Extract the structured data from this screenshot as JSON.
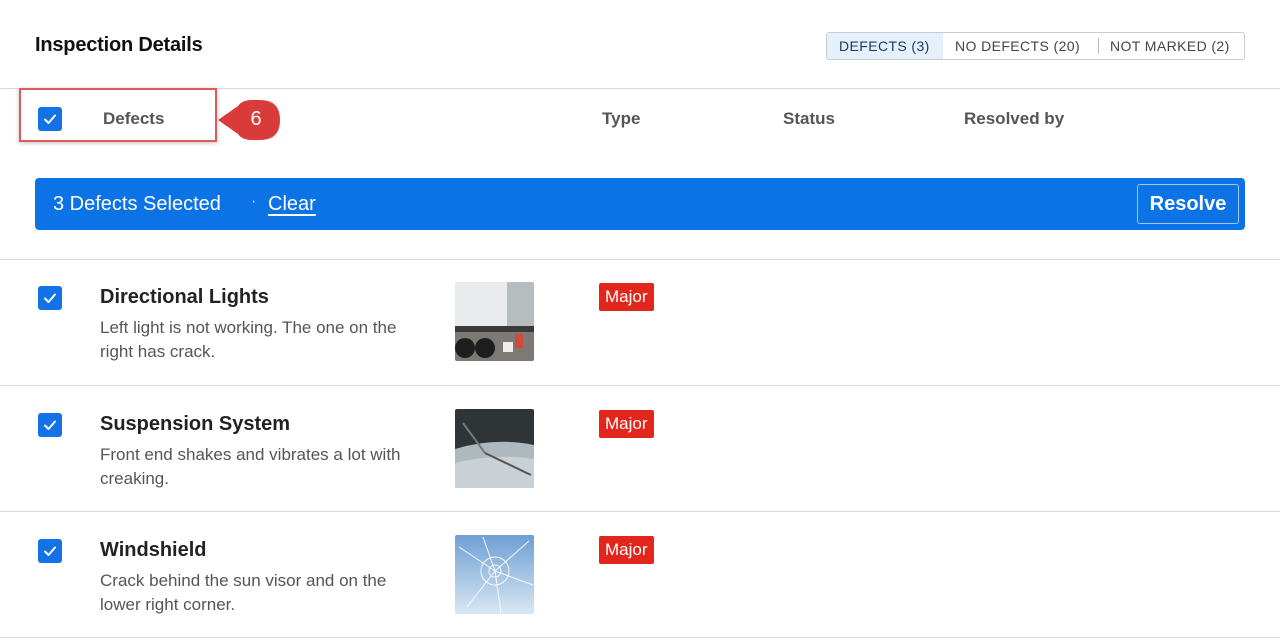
{
  "header": {
    "title": "Inspection Details",
    "filters": [
      {
        "label": "DEFECTS (3)",
        "active": true
      },
      {
        "label": "NO DEFECTS (20)",
        "active": false
      },
      {
        "label": "NOT MARKED (2)",
        "active": false
      }
    ]
  },
  "table": {
    "columns": {
      "defects": "Defects",
      "type": "Type",
      "status": "Status",
      "resolved_by": "Resolved by"
    },
    "select_all_checked": true
  },
  "annotation": {
    "step": "6"
  },
  "bulk_bar": {
    "count_text": "3 Defects Selected",
    "separator": "·",
    "clear_label": "Clear",
    "resolve_label": "Resolve"
  },
  "rows": [
    {
      "title": "Directional Lights",
      "description": "Left light is not working. The one on the right has crack.",
      "type": "Major",
      "checked": true
    },
    {
      "title": "Suspension System",
      "description": "Front end shakes and vibrates a lot with creaking.",
      "type": "Major",
      "checked": true
    },
    {
      "title": "Windshield",
      "description": "Crack behind the sun visor and on the lower right corner.",
      "type": "Major",
      "checked": true
    }
  ],
  "colors": {
    "accent": "#0b73e6",
    "badge": "#e3261b",
    "callout": "#d93a3a"
  }
}
